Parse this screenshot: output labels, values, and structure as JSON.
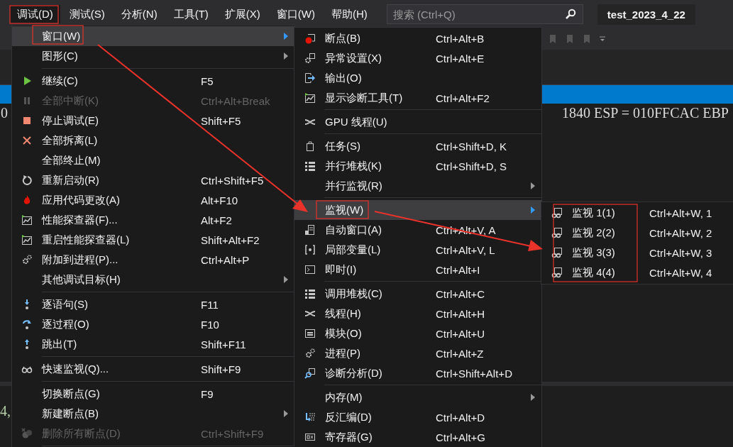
{
  "menu_bar": {
    "items": [
      {
        "label": "调试(D)",
        "selected": true
      },
      {
        "label": "测试(S)",
        "selected": false
      },
      {
        "label": "分析(N)",
        "selected": false
      },
      {
        "label": "工具(T)",
        "selected": false
      },
      {
        "label": "扩展(X)",
        "selected": false
      },
      {
        "label": "窗口(W)",
        "selected": false
      },
      {
        "label": "帮助(H)",
        "selected": false
      }
    ],
    "search": {
      "placeholder": "搜索 (Ctrl+Q)"
    },
    "solution_name": "test_2023_4_22"
  },
  "editor": {
    "line_fragment": "0",
    "register_line": "1840 ESP = 010FFCAC EBP",
    "output_fragment": "4,"
  },
  "debug_menu": {
    "items": [
      {
        "kind": "item",
        "label": "窗口(W)",
        "submenu": true,
        "disabled": false,
        "selected": true
      },
      {
        "kind": "item",
        "label": "图形(C)",
        "submenu": true,
        "disabled": false,
        "selected": false
      },
      {
        "kind": "separator"
      },
      {
        "kind": "item",
        "label": "继续(C)",
        "shortcut": "F5",
        "submenu": false,
        "disabled": false,
        "selected": false
      },
      {
        "kind": "item",
        "label": "全部中断(K)",
        "shortcut": "Ctrl+Alt+Break",
        "submenu": false,
        "disabled": true,
        "selected": false
      },
      {
        "kind": "item",
        "label": "停止调试(E)",
        "shortcut": "Shift+F5",
        "submenu": false,
        "disabled": false,
        "selected": false
      },
      {
        "kind": "item",
        "label": "全部拆离(L)",
        "submenu": false,
        "disabled": false,
        "selected": false
      },
      {
        "kind": "item",
        "label": "全部终止(M)",
        "submenu": false,
        "disabled": false,
        "selected": false
      },
      {
        "kind": "item",
        "label": "重新启动(R)",
        "shortcut": "Ctrl+Shift+F5",
        "submenu": false,
        "disabled": false,
        "selected": false
      },
      {
        "kind": "item",
        "label": "应用代码更改(A)",
        "shortcut": "Alt+F10",
        "submenu": false,
        "disabled": false,
        "selected": false
      },
      {
        "kind": "item",
        "label": "性能探查器(F)...",
        "shortcut": "Alt+F2",
        "submenu": false,
        "disabled": false,
        "selected": false
      },
      {
        "kind": "item",
        "label": "重启性能探查器(L)",
        "shortcut": "Shift+Alt+F2",
        "submenu": false,
        "disabled": false,
        "selected": false
      },
      {
        "kind": "item",
        "label": "附加到进程(P)...",
        "shortcut": "Ctrl+Alt+P",
        "submenu": false,
        "disabled": false,
        "selected": false
      },
      {
        "kind": "item",
        "label": "其他调试目标(H)",
        "submenu": true,
        "disabled": false,
        "selected": false
      },
      {
        "kind": "separator"
      },
      {
        "kind": "item",
        "label": "逐语句(S)",
        "shortcut": "F11",
        "submenu": false,
        "disabled": false,
        "selected": false
      },
      {
        "kind": "item",
        "label": "逐过程(O)",
        "shortcut": "F10",
        "submenu": false,
        "disabled": false,
        "selected": false
      },
      {
        "kind": "item",
        "label": "跳出(T)",
        "shortcut": "Shift+F11",
        "submenu": false,
        "disabled": false,
        "selected": false
      },
      {
        "kind": "separator"
      },
      {
        "kind": "item",
        "label": "快速监视(Q)...",
        "shortcut": "Shift+F9",
        "submenu": false,
        "disabled": false,
        "selected": false
      },
      {
        "kind": "separator"
      },
      {
        "kind": "item",
        "label": "切换断点(G)",
        "shortcut": "F9",
        "submenu": false,
        "disabled": false,
        "selected": false
      },
      {
        "kind": "item",
        "label": "新建断点(B)",
        "submenu": true,
        "disabled": false,
        "selected": false
      },
      {
        "kind": "item",
        "label": "删除所有断点(D)",
        "shortcut": "Ctrl+Shift+F9",
        "submenu": false,
        "disabled": true,
        "selected": false
      },
      {
        "kind": "separator"
      }
    ]
  },
  "window_menu": {
    "items": [
      {
        "kind": "item",
        "label": "断点(B)",
        "shortcut": "Ctrl+Alt+B",
        "submenu": false,
        "selected": false
      },
      {
        "kind": "item",
        "label": "异常设置(X)",
        "shortcut": "Ctrl+Alt+E",
        "submenu": false,
        "selected": false
      },
      {
        "kind": "item",
        "label": "输出(O)",
        "submenu": false,
        "selected": false
      },
      {
        "kind": "item",
        "label": "显示诊断工具(T)",
        "shortcut": "Ctrl+Alt+F2",
        "submenu": false,
        "selected": false
      },
      {
        "kind": "separator"
      },
      {
        "kind": "item",
        "label": "GPU 线程(U)",
        "submenu": false,
        "selected": false
      },
      {
        "kind": "separator"
      },
      {
        "kind": "item",
        "label": "任务(S)",
        "shortcut": "Ctrl+Shift+D, K",
        "submenu": false,
        "selected": false
      },
      {
        "kind": "item",
        "label": "并行堆栈(K)",
        "shortcut": "Ctrl+Shift+D, S",
        "submenu": false,
        "selected": false
      },
      {
        "kind": "item",
        "label": "并行监视(R)",
        "submenu": true,
        "selected": false
      },
      {
        "kind": "separator"
      },
      {
        "kind": "item",
        "label": "监视(W)",
        "submenu": true,
        "selected": true
      },
      {
        "kind": "item",
        "label": "自动窗口(A)",
        "shortcut": "Ctrl+Alt+V, A",
        "submenu": false,
        "selected": false
      },
      {
        "kind": "item",
        "label": "局部变量(L)",
        "shortcut": "Ctrl+Alt+V, L",
        "submenu": false,
        "selected": false
      },
      {
        "kind": "item",
        "label": "即时(I)",
        "shortcut": "Ctrl+Alt+I",
        "submenu": false,
        "selected": false
      },
      {
        "kind": "separator"
      },
      {
        "kind": "item",
        "label": "调用堆栈(C)",
        "shortcut": "Ctrl+Alt+C",
        "submenu": false,
        "selected": false
      },
      {
        "kind": "item",
        "label": "线程(H)",
        "shortcut": "Ctrl+Alt+H",
        "submenu": false,
        "selected": false
      },
      {
        "kind": "item",
        "label": "模块(O)",
        "shortcut": "Ctrl+Alt+U",
        "submenu": false,
        "selected": false
      },
      {
        "kind": "item",
        "label": "进程(P)",
        "shortcut": "Ctrl+Alt+Z",
        "submenu": false,
        "selected": false
      },
      {
        "kind": "item",
        "label": "诊断分析(D)",
        "shortcut": "Ctrl+Shift+Alt+D",
        "submenu": false,
        "selected": false
      },
      {
        "kind": "separator"
      },
      {
        "kind": "item",
        "label": "内存(M)",
        "submenu": true,
        "selected": false
      },
      {
        "kind": "item",
        "label": "反汇编(D)",
        "shortcut": "Ctrl+Alt+D",
        "submenu": false,
        "selected": false
      },
      {
        "kind": "item",
        "label": "寄存器(G)",
        "shortcut": "Ctrl+Alt+G",
        "submenu": false,
        "selected": false
      }
    ]
  },
  "watch_menu": {
    "items": [
      {
        "kind": "item",
        "label": "监视 1(1)",
        "shortcut": "Ctrl+Alt+W, 1",
        "submenu": false,
        "selected": false
      },
      {
        "kind": "item",
        "label": "监视 2(2)",
        "shortcut": "Ctrl+Alt+W, 2",
        "submenu": false,
        "selected": false
      },
      {
        "kind": "item",
        "label": "监视 3(3)",
        "shortcut": "Ctrl+Alt+W, 3",
        "submenu": false,
        "selected": false
      },
      {
        "kind": "item",
        "label": "监视 4(4)",
        "shortcut": "Ctrl+Alt+W, 4",
        "submenu": false,
        "selected": false
      }
    ]
  }
}
